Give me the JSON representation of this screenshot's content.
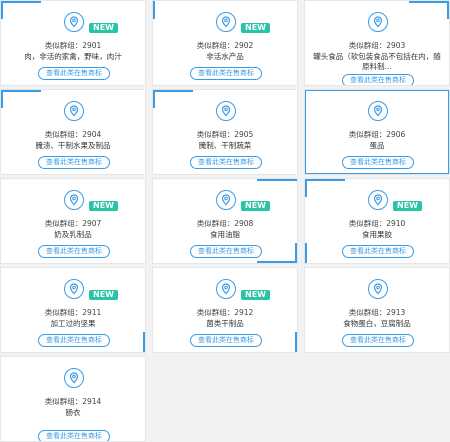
{
  "group_prefix": "类似群组：",
  "new_label": "NEW",
  "button_label": "查看此类在售商标",
  "cards": [
    {
      "code": "2901",
      "desc": "肉，非活的家禽，野味，肉汁",
      "is_new": true
    },
    {
      "code": "2902",
      "desc": "非活水产品",
      "is_new": true
    },
    {
      "code": "2903",
      "desc": "罐头食品（软包装食品不包括在内，随原料制...",
      "is_new": false
    },
    {
      "code": "2904",
      "desc": "腌渍、干制水果及制品",
      "is_new": false
    },
    {
      "code": "2905",
      "desc": "腌制、干制蔬菜",
      "is_new": false
    },
    {
      "code": "2906",
      "desc": "蛋品",
      "is_new": false
    },
    {
      "code": "2907",
      "desc": "奶及乳制品",
      "is_new": true
    },
    {
      "code": "2908",
      "desc": "食用油脂",
      "is_new": true
    },
    {
      "code": "2910",
      "desc": "食用果胶",
      "is_new": true
    },
    {
      "code": "2911",
      "desc": "加工过的坚果",
      "is_new": true
    },
    {
      "code": "2912",
      "desc": "菌类干制品",
      "is_new": true
    },
    {
      "code": "2913",
      "desc": "食物蛋白，豆腐制品",
      "is_new": false
    },
    {
      "code": "2914",
      "desc": "肠衣",
      "is_new": false
    }
  ],
  "colors": {
    "accent": "#3a9be6",
    "badge": "#29c3a8",
    "background": "#f2f2f2"
  },
  "icons": {
    "card_icon": "map-pin-icon"
  }
}
